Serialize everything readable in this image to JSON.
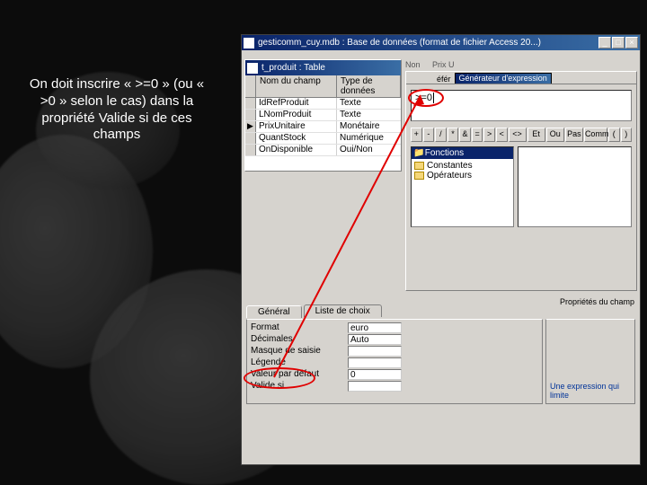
{
  "annotation": "On doit inscrire « >=0 » (ou « >0 » selon le cas) dans la propriété Valide si de ces champs",
  "main_window": {
    "title": "gesticomm_cuy.mdb : Base de données (format de fichier Access 20...)"
  },
  "table_window": {
    "title": "t_produit : Table",
    "columns": {
      "field": "Nom du champ",
      "type": "Type de données"
    },
    "rows": [
      {
        "name": "IdRefProduit",
        "type": "Texte"
      },
      {
        "name": "LNomProduit",
        "type": "Texte"
      },
      {
        "name": "PrixUnitaire",
        "type": "Monétaire",
        "selected": true
      },
      {
        "name": "QuantStock",
        "type": "Numérique"
      },
      {
        "name": "OnDisponible",
        "type": "Oui/Non"
      }
    ]
  },
  "builder": {
    "tab_prefix": "éfér",
    "tab_label": "Générateur d'expression",
    "expression": ">=0",
    "ops": [
      "+",
      "-",
      "/",
      "*",
      "&",
      "=",
      ">",
      "<",
      "<>",
      "Et",
      "Ou",
      "Pas",
      "Comme",
      "(",
      ")"
    ],
    "tree_header": "Fonctions",
    "tree": [
      "Constantes",
      "Opérateurs"
    ]
  },
  "section_label": "Propriétés du champ",
  "tabs": {
    "general": "Général",
    "list": "Liste de choix"
  },
  "props": [
    {
      "name": "Format",
      "value": "euro"
    },
    {
      "name": "Décimales",
      "value": "Auto"
    },
    {
      "name": "Masque de saisie",
      "value": ""
    },
    {
      "name": "Légende",
      "value": ""
    },
    {
      "name": "Valeur par défaut",
      "value": "0"
    },
    {
      "name": "Valide si",
      "value": ""
    }
  ],
  "hint": "Une expression qui limite"
}
